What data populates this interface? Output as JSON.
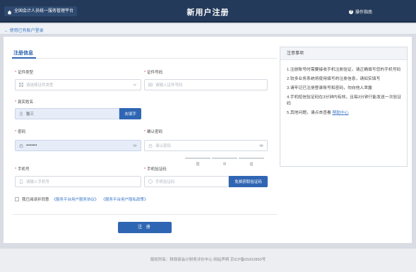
{
  "header": {
    "platform_name": "全国会计人员统一服务管理平台",
    "page_title": "新用户注册",
    "guide_label": "操作指南"
  },
  "back_link": "← 使用已有账户登录",
  "tab": {
    "label": "注册信息"
  },
  "form": {
    "id_type": {
      "label": "证件类型",
      "placeholder": "请选择证件类型"
    },
    "id_number": {
      "label": "证件号码",
      "placeholder": "请输入证件号码"
    },
    "real_name": {
      "label": "真实姓名",
      "value": "张三",
      "button": "去填字"
    },
    "password": {
      "label": "密码",
      "value": "••••••••"
    },
    "confirm_password": {
      "label": "确认密码",
      "placeholder": "请认密码"
    },
    "strength": [
      "弱",
      "中",
      "强"
    ],
    "phone": {
      "label": "手机号",
      "placeholder": "请输入手机号"
    },
    "sms_code": {
      "label": "手机验证码",
      "placeholder": "手机验证码",
      "button": "免费获取验证码"
    },
    "agree": {
      "text": "我已阅读并同意",
      "link1": "《服务平台用户服务协议》",
      "link2": "《服务平台用户隐私政策》"
    },
    "submit": "注 册"
  },
  "notice": {
    "title": "注意事项",
    "items": [
      "1.注册账号时需要接收手机注册验证，请正确填写您的手机号码",
      "2.较多业务系统将使用填写的注册信息，请如实填写",
      "3.请牢记已注册登录账号和密码，勿向他人泄露",
      "4.手机短信验证码在3分钟内有效，且每3分钟只能发送一次验证码"
    ],
    "item5_text": "5.其他问题，请点击查看",
    "item5_link": "帮助中心"
  },
  "footer": "版权所有：财政部会计财务评价中心 网站声明 京ICP备05002860号",
  "colors": {
    "header_bg": "#243a5a",
    "primary": "#2f66b3",
    "link": "#3a77c8",
    "required": "#e04040"
  },
  "icons": [
    "home-icon",
    "help-icon",
    "id-card-icon",
    "chevron-down-icon",
    "user-icon",
    "lock-icon",
    "eye-icon",
    "phone-icon",
    "shield-icon"
  ]
}
